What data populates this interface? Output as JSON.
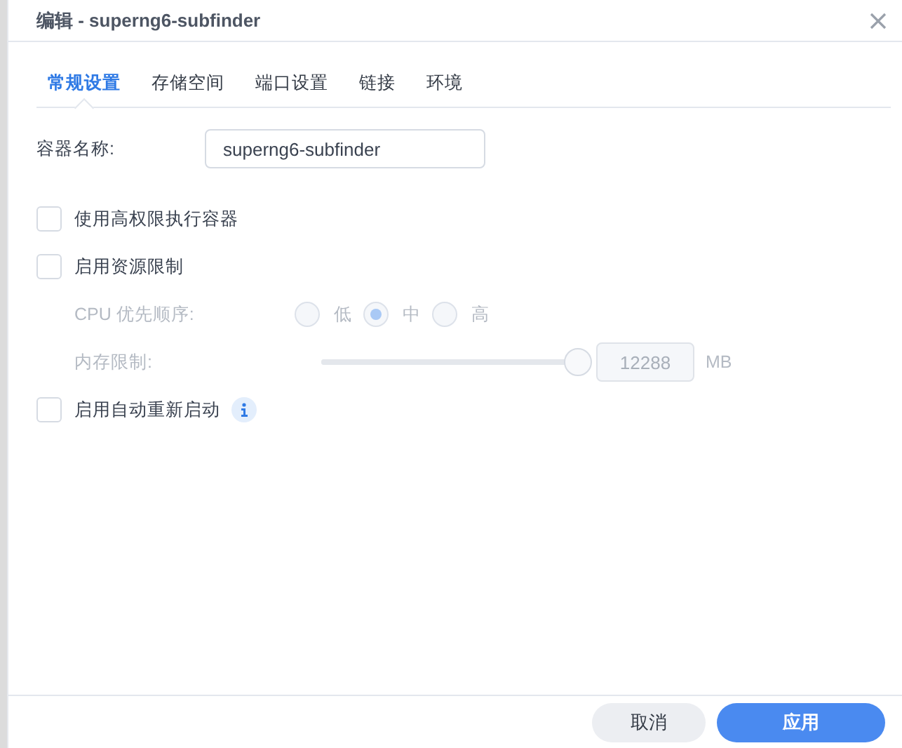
{
  "window": {
    "title": "编辑 - superng6-subfinder"
  },
  "tabs": [
    {
      "label": "常规设置",
      "selected": true
    },
    {
      "label": "存储空间",
      "selected": false
    },
    {
      "label": "端口设置",
      "selected": false
    },
    {
      "label": "链接",
      "selected": false
    },
    {
      "label": "环境",
      "selected": false
    }
  ],
  "name_field": {
    "label": "容器名称:",
    "value": "superng6-subfinder"
  },
  "privileged": {
    "label": "使用高权限执行容器",
    "checked": false
  },
  "resource_limit": {
    "label": "启用资源限制",
    "checked": false,
    "disabled": true,
    "cpu": {
      "label": "CPU 优先顺序:",
      "options": [
        {
          "label": "低",
          "selected": false
        },
        {
          "label": "中",
          "selected": true
        },
        {
          "label": "高",
          "selected": false
        }
      ]
    },
    "memory": {
      "label": "内存限制:",
      "level": 1,
      "value": "12288",
      "unit": "MB"
    }
  },
  "auto_restart": {
    "label": "启用自动重新启动",
    "checked": false,
    "info": true
  },
  "buttons": [
    {
      "label": "取消",
      "kind": "secondary"
    },
    {
      "label": "应用",
      "kind": "primary"
    }
  ]
}
